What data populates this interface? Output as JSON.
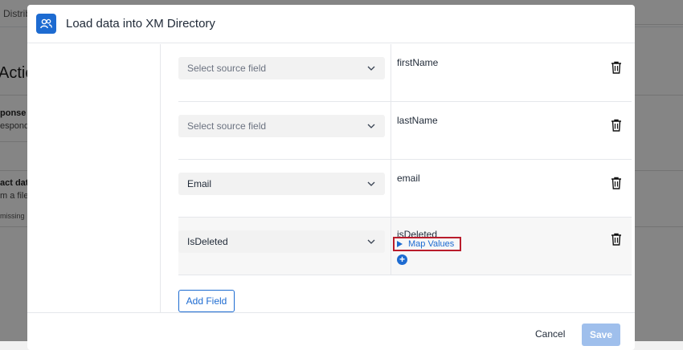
{
  "background": {
    "tab_fragment": "Distrib",
    "title_fragment": "Actio",
    "sections": [
      {
        "bold": "ponse",
        "sub": "espond"
      },
      {
        "bold": "act dat",
        "sub": "m a file"
      },
      {
        "bold": "",
        "sub": "missing"
      }
    ]
  },
  "modal": {
    "title": "Load data into XM Directory",
    "header_icon": "users-icon",
    "rows": [
      {
        "source": "Select source field",
        "source_is_placeholder": true,
        "destination": "firstName"
      },
      {
        "source": "Select source field",
        "source_is_placeholder": true,
        "destination": "lastName"
      },
      {
        "source": "Email",
        "source_is_placeholder": false,
        "destination": "email"
      },
      {
        "source": "IsDeleted",
        "source_is_placeholder": false,
        "destination": "isDeleted",
        "map_values_label": "Map Values"
      }
    ],
    "add_field_label": "Add Field",
    "cancel_label": "Cancel",
    "save_label": "Save"
  },
  "colors": {
    "accent": "#1d6bd1",
    "highlight_border": "#b91c2c",
    "save_disabled": "#9fbfec"
  }
}
